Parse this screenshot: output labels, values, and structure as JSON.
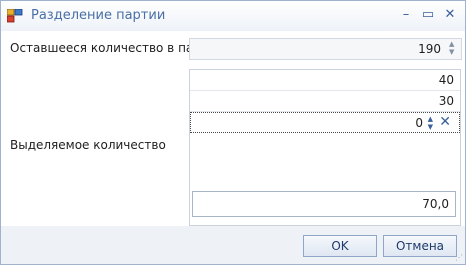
{
  "window": {
    "title": "Разделение партии",
    "icons": {
      "app": "app-icon",
      "minimize": "minimize-icon",
      "maximize": "maximize-icon",
      "close": "close-icon"
    },
    "accent": "#4a6fa5"
  },
  "remaining": {
    "label": "Оставшееся количество в партии",
    "value": "190"
  },
  "allocated": {
    "label": "Выделяемое количество",
    "rows": [
      "40",
      "30",
      "0"
    ],
    "total": "70,0"
  },
  "buttons": {
    "ok": "OK",
    "cancel": "Отмена"
  }
}
